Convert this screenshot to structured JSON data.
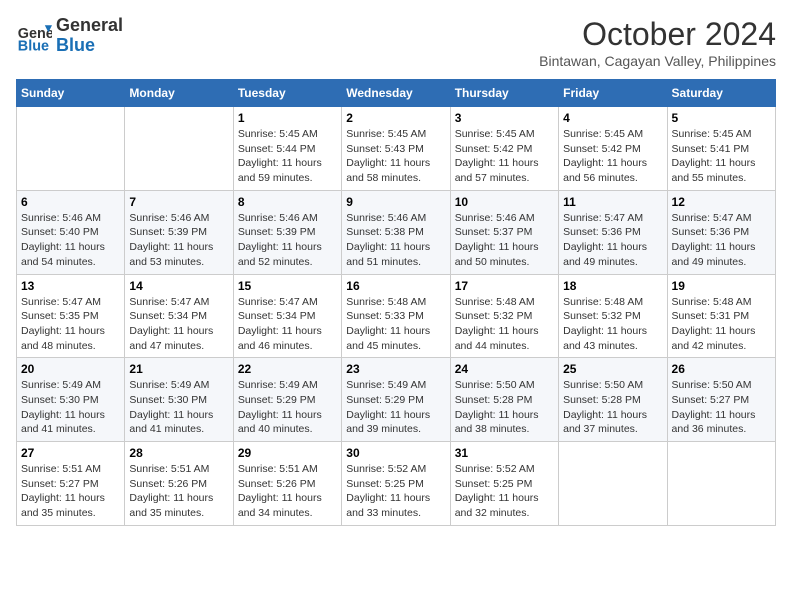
{
  "header": {
    "logo_line1": "General",
    "logo_line2": "Blue",
    "month_title": "October 2024",
    "location": "Bintawan, Cagayan Valley, Philippines"
  },
  "weekdays": [
    "Sunday",
    "Monday",
    "Tuesday",
    "Wednesday",
    "Thursday",
    "Friday",
    "Saturday"
  ],
  "weeks": [
    [
      {
        "day": "",
        "info": ""
      },
      {
        "day": "",
        "info": ""
      },
      {
        "day": "1",
        "info": "Sunrise: 5:45 AM\nSunset: 5:44 PM\nDaylight: 11 hours and 59 minutes."
      },
      {
        "day": "2",
        "info": "Sunrise: 5:45 AM\nSunset: 5:43 PM\nDaylight: 11 hours and 58 minutes."
      },
      {
        "day": "3",
        "info": "Sunrise: 5:45 AM\nSunset: 5:42 PM\nDaylight: 11 hours and 57 minutes."
      },
      {
        "day": "4",
        "info": "Sunrise: 5:45 AM\nSunset: 5:42 PM\nDaylight: 11 hours and 56 minutes."
      },
      {
        "day": "5",
        "info": "Sunrise: 5:45 AM\nSunset: 5:41 PM\nDaylight: 11 hours and 55 minutes."
      }
    ],
    [
      {
        "day": "6",
        "info": "Sunrise: 5:46 AM\nSunset: 5:40 PM\nDaylight: 11 hours and 54 minutes."
      },
      {
        "day": "7",
        "info": "Sunrise: 5:46 AM\nSunset: 5:39 PM\nDaylight: 11 hours and 53 minutes."
      },
      {
        "day": "8",
        "info": "Sunrise: 5:46 AM\nSunset: 5:39 PM\nDaylight: 11 hours and 52 minutes."
      },
      {
        "day": "9",
        "info": "Sunrise: 5:46 AM\nSunset: 5:38 PM\nDaylight: 11 hours and 51 minutes."
      },
      {
        "day": "10",
        "info": "Sunrise: 5:46 AM\nSunset: 5:37 PM\nDaylight: 11 hours and 50 minutes."
      },
      {
        "day": "11",
        "info": "Sunrise: 5:47 AM\nSunset: 5:36 PM\nDaylight: 11 hours and 49 minutes."
      },
      {
        "day": "12",
        "info": "Sunrise: 5:47 AM\nSunset: 5:36 PM\nDaylight: 11 hours and 49 minutes."
      }
    ],
    [
      {
        "day": "13",
        "info": "Sunrise: 5:47 AM\nSunset: 5:35 PM\nDaylight: 11 hours and 48 minutes."
      },
      {
        "day": "14",
        "info": "Sunrise: 5:47 AM\nSunset: 5:34 PM\nDaylight: 11 hours and 47 minutes."
      },
      {
        "day": "15",
        "info": "Sunrise: 5:47 AM\nSunset: 5:34 PM\nDaylight: 11 hours and 46 minutes."
      },
      {
        "day": "16",
        "info": "Sunrise: 5:48 AM\nSunset: 5:33 PM\nDaylight: 11 hours and 45 minutes."
      },
      {
        "day": "17",
        "info": "Sunrise: 5:48 AM\nSunset: 5:32 PM\nDaylight: 11 hours and 44 minutes."
      },
      {
        "day": "18",
        "info": "Sunrise: 5:48 AM\nSunset: 5:32 PM\nDaylight: 11 hours and 43 minutes."
      },
      {
        "day": "19",
        "info": "Sunrise: 5:48 AM\nSunset: 5:31 PM\nDaylight: 11 hours and 42 minutes."
      }
    ],
    [
      {
        "day": "20",
        "info": "Sunrise: 5:49 AM\nSunset: 5:30 PM\nDaylight: 11 hours and 41 minutes."
      },
      {
        "day": "21",
        "info": "Sunrise: 5:49 AM\nSunset: 5:30 PM\nDaylight: 11 hours and 41 minutes."
      },
      {
        "day": "22",
        "info": "Sunrise: 5:49 AM\nSunset: 5:29 PM\nDaylight: 11 hours and 40 minutes."
      },
      {
        "day": "23",
        "info": "Sunrise: 5:49 AM\nSunset: 5:29 PM\nDaylight: 11 hours and 39 minutes."
      },
      {
        "day": "24",
        "info": "Sunrise: 5:50 AM\nSunset: 5:28 PM\nDaylight: 11 hours and 38 minutes."
      },
      {
        "day": "25",
        "info": "Sunrise: 5:50 AM\nSunset: 5:28 PM\nDaylight: 11 hours and 37 minutes."
      },
      {
        "day": "26",
        "info": "Sunrise: 5:50 AM\nSunset: 5:27 PM\nDaylight: 11 hours and 36 minutes."
      }
    ],
    [
      {
        "day": "27",
        "info": "Sunrise: 5:51 AM\nSunset: 5:27 PM\nDaylight: 11 hours and 35 minutes."
      },
      {
        "day": "28",
        "info": "Sunrise: 5:51 AM\nSunset: 5:26 PM\nDaylight: 11 hours and 35 minutes."
      },
      {
        "day": "29",
        "info": "Sunrise: 5:51 AM\nSunset: 5:26 PM\nDaylight: 11 hours and 34 minutes."
      },
      {
        "day": "30",
        "info": "Sunrise: 5:52 AM\nSunset: 5:25 PM\nDaylight: 11 hours and 33 minutes."
      },
      {
        "day": "31",
        "info": "Sunrise: 5:52 AM\nSunset: 5:25 PM\nDaylight: 11 hours and 32 minutes."
      },
      {
        "day": "",
        "info": ""
      },
      {
        "day": "",
        "info": ""
      }
    ]
  ]
}
